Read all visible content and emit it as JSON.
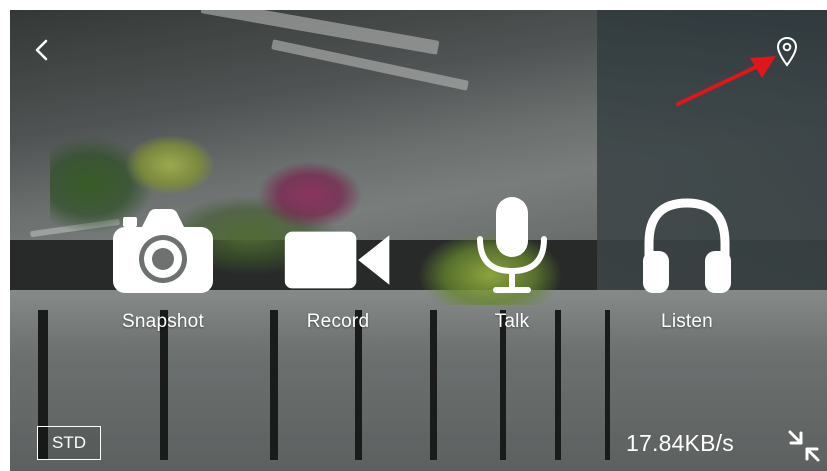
{
  "controls": {
    "snapshot_label": "Snapshot",
    "record_label": "Record",
    "talk_label": "Talk",
    "listen_label": "Listen"
  },
  "stream": {
    "quality_label": "STD",
    "bitrate": "17.84KB/s"
  },
  "icons": {
    "back": "back-chevron-icon",
    "location": "location-pin-icon",
    "snapshot": "camera-icon",
    "record": "video-camera-icon",
    "talk": "microphone-icon",
    "listen": "headphones-icon",
    "fullscreen": "exit-fullscreen-icon"
  },
  "colors": {
    "icon": "#ffffff",
    "annotation_arrow": "#e0161b"
  }
}
